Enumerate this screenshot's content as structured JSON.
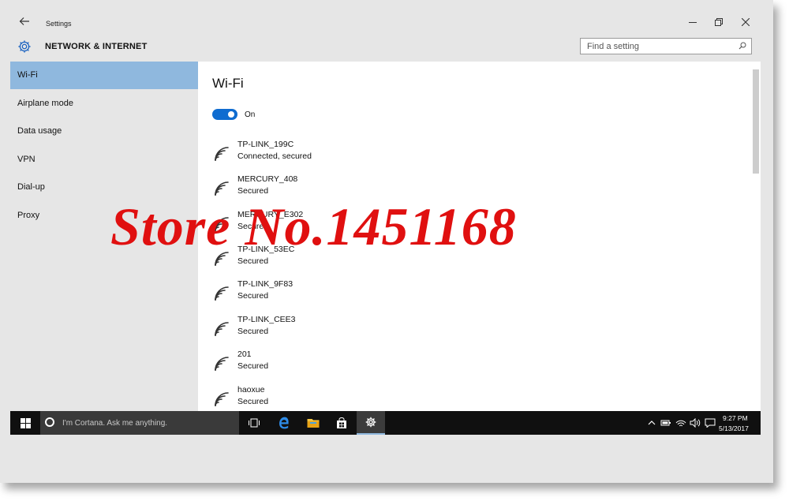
{
  "window": {
    "title": "Settings",
    "section_title": "NETWORK & INTERNET"
  },
  "search": {
    "placeholder": "Find a setting"
  },
  "sidebar": {
    "items": [
      {
        "label": "Wi-Fi",
        "active": true
      },
      {
        "label": "Airplane mode",
        "active": false
      },
      {
        "label": "Data usage",
        "active": false
      },
      {
        "label": "VPN",
        "active": false
      },
      {
        "label": "Dial-up",
        "active": false
      },
      {
        "label": "Proxy",
        "active": false
      }
    ]
  },
  "main": {
    "title": "Wi-Fi",
    "toggle_label": "On",
    "networks": [
      {
        "ssid": "TP-LINK_199C",
        "status": "Connected, secured"
      },
      {
        "ssid": "MERCURY_408",
        "status": "Secured"
      },
      {
        "ssid": "MERCURY_E302",
        "status": "Secured"
      },
      {
        "ssid": "TP-LINK_53EC",
        "status": "Secured"
      },
      {
        "ssid": "TP-LINK_9F83",
        "status": "Secured"
      },
      {
        "ssid": "TP-LINK_CEE3",
        "status": "Secured"
      },
      {
        "ssid": "201",
        "status": "Secured"
      },
      {
        "ssid": "haoxue",
        "status": "Secured"
      }
    ]
  },
  "watermark": "Store No.1451168",
  "taskbar": {
    "cortana_placeholder": "I'm Cortana. Ask me anything.",
    "time": "9:27 PM",
    "date": "5/13/2017"
  },
  "colors": {
    "accent": "#0f6cd0",
    "sidebar_selected": "#8fb8de",
    "watermark": "#e01010",
    "taskbar": "#101010"
  }
}
